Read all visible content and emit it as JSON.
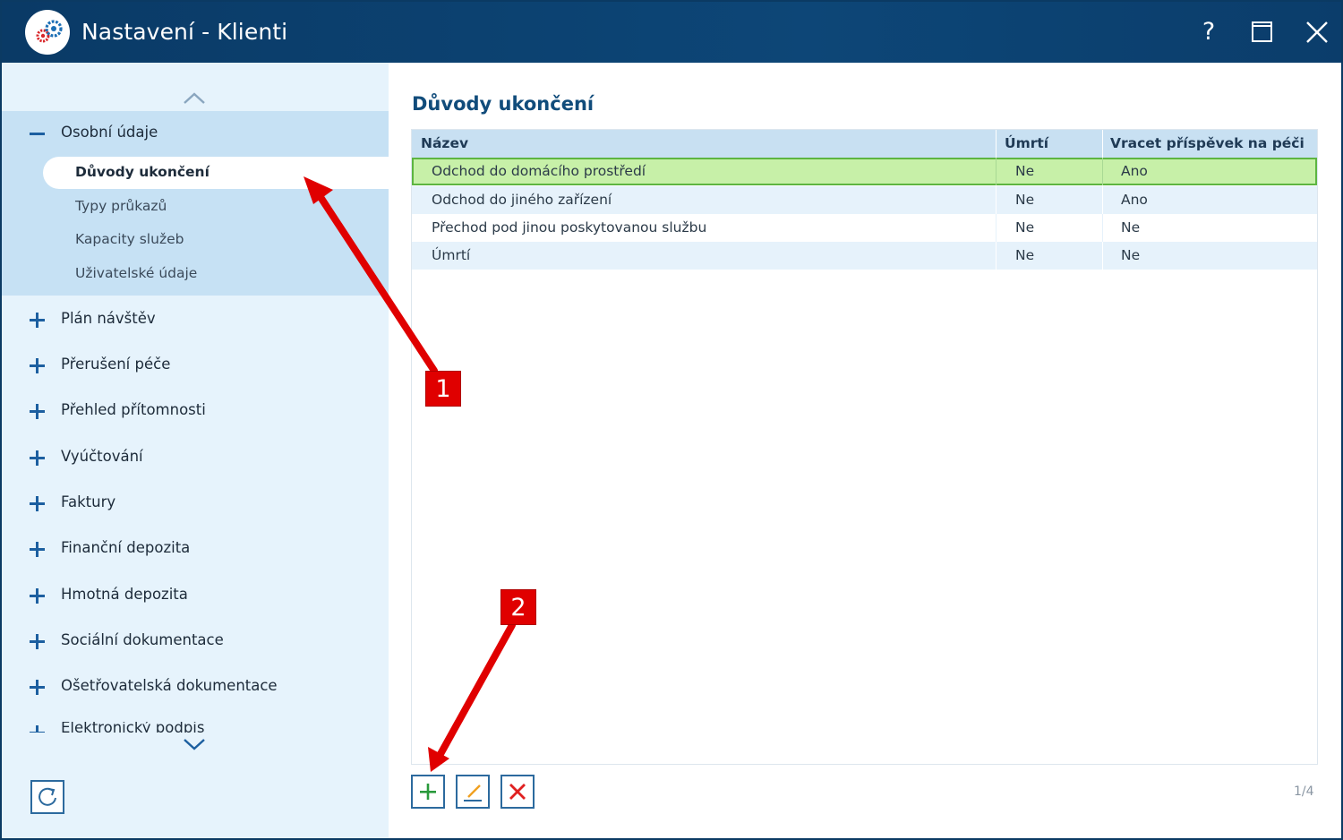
{
  "window": {
    "title": "Nastavení - Klienti",
    "help_label": "?"
  },
  "sidebar": {
    "groups": [
      {
        "label": "Osobní údaje",
        "expanded": true,
        "items": [
          {
            "label": "Důvody ukončení",
            "active": true
          },
          {
            "label": "Typy průkazů"
          },
          {
            "label": "Kapacity služeb"
          },
          {
            "label": "Uživatelské údaje"
          }
        ]
      },
      {
        "label": "Plán návštěv"
      },
      {
        "label": "Přerušení péče"
      },
      {
        "label": "Přehled přítomnosti"
      },
      {
        "label": "Vyúčtování"
      },
      {
        "label": "Faktury"
      },
      {
        "label": "Finanční depozita"
      },
      {
        "label": "Hmotná depozita"
      },
      {
        "label": "Sociální dokumentace"
      },
      {
        "label": "Ošetřovatelská dokumentace"
      },
      {
        "label": "Elektronický podpis"
      }
    ]
  },
  "main": {
    "title": "Důvody ukončení",
    "columns": [
      "Název",
      "Úmrtí",
      "Vracet příspěvek na péči"
    ],
    "rows": [
      [
        "Odchod do domácího prostředí",
        "Ne",
        "Ano"
      ],
      [
        "Odchod do jiného zařízení",
        "Ne",
        "Ano"
      ],
      [
        "Přechod pod jinou poskytovanou službu",
        "Ne",
        "Ne"
      ],
      [
        "Úmrtí",
        "Ne",
        "Ne"
      ]
    ],
    "selected_row": 0,
    "pager": "1/4"
  },
  "annotations": [
    {
      "label": "1",
      "color": "#e00000"
    },
    {
      "label": "2",
      "color": "#e00000"
    }
  ],
  "colors": {
    "titlebar": "#0a3a66",
    "sidebar_bg": "#e6f3fc",
    "group_bg": "#c6e1f4",
    "header_bg": "#c8e0f2",
    "selected_row": "#c7f0a8",
    "accent": "#2c6a9e",
    "title_color": "#114c7b"
  }
}
